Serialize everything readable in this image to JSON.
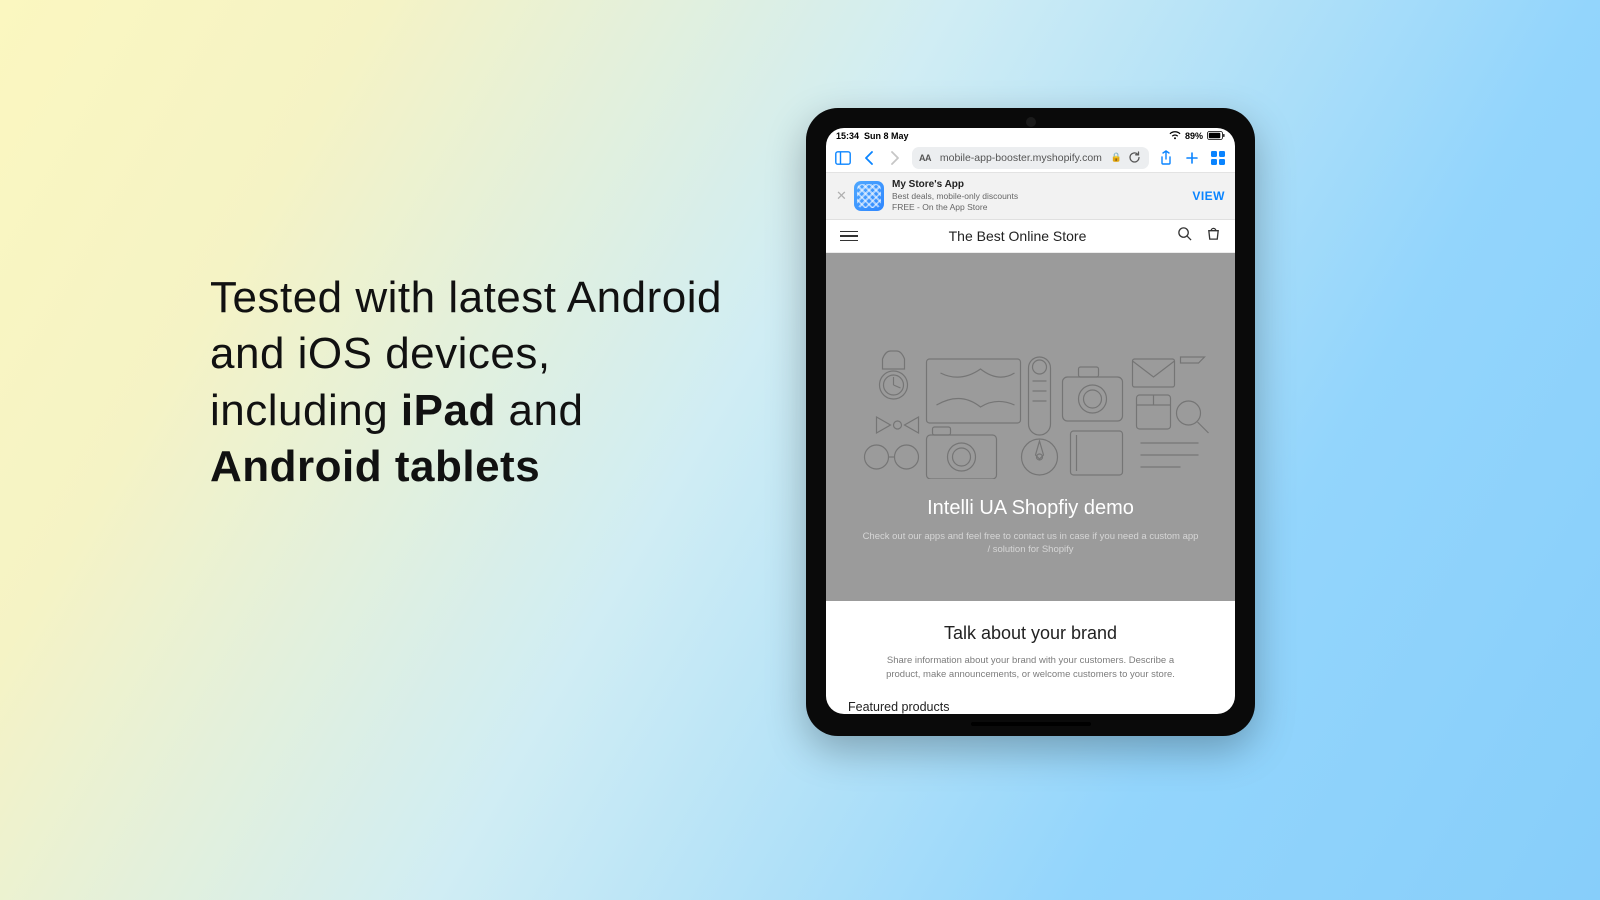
{
  "marketing": {
    "headline_pre": "Tested with latest Android and iOS devices, including ",
    "headline_b1": "iPad",
    "headline_mid": " and ",
    "headline_b2": "Android tablets"
  },
  "status": {
    "time": "15:34",
    "date": "Sun 8 May",
    "battery": "89%"
  },
  "safari": {
    "aa": "AA",
    "url": "mobile-app-booster.myshopify.com"
  },
  "smartbanner": {
    "title": "My Store's App",
    "subtitle": "Best deals, mobile-only discounts",
    "meta": "FREE - On the App Store",
    "view": "VIEW"
  },
  "store": {
    "title": "The Best Online Store",
    "hero_title": "Intelli UA Shopfiy demo",
    "hero_sub": "Check out our apps and feel free to contact us in case if you need a custom app / solution for Shopify",
    "brand_title": "Talk about your brand",
    "brand_sub": "Share information about your brand with your customers. Describe a product, make announcements, or welcome customers to your store.",
    "featured": "Featured products"
  }
}
